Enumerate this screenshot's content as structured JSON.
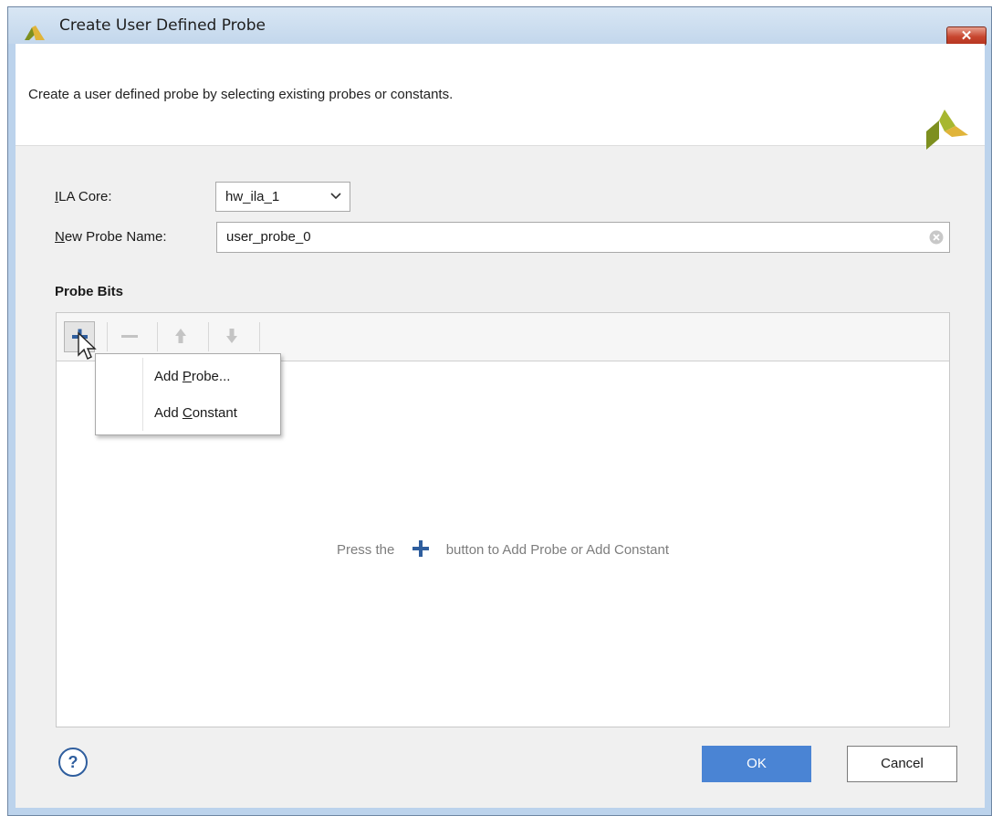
{
  "window": {
    "title": "Create User Defined Probe",
    "close_label": "✕"
  },
  "header": {
    "description": "Create a user defined probe by selecting existing probes or constants."
  },
  "form": {
    "ila_core": {
      "label_mnemonic": "I",
      "label_rest": "LA Core:",
      "value": "hw_ila_1"
    },
    "probe_name": {
      "label_mnemonic": "N",
      "label_rest": "ew Probe Name:",
      "value": "user_probe_0"
    }
  },
  "probe_bits": {
    "title": "Probe Bits",
    "toolbar": [
      "plus-icon",
      "minus-icon",
      "arrow-up-icon",
      "arrow-down-icon"
    ],
    "hint_before": "Press the",
    "hint_after": "button to Add Probe or Add Constant"
  },
  "menu": {
    "items": [
      {
        "pre": "Add ",
        "mnemonic": "P",
        "post": "robe..."
      },
      {
        "pre": "Add ",
        "mnemonic": "C",
        "post": "onstant"
      }
    ]
  },
  "buttons": {
    "help": "?",
    "ok": "OK",
    "cancel": "Cancel"
  },
  "colors": {
    "accent": "#4a84d4",
    "plus_icon": "#2f5e9e",
    "close": "#c7452e"
  }
}
